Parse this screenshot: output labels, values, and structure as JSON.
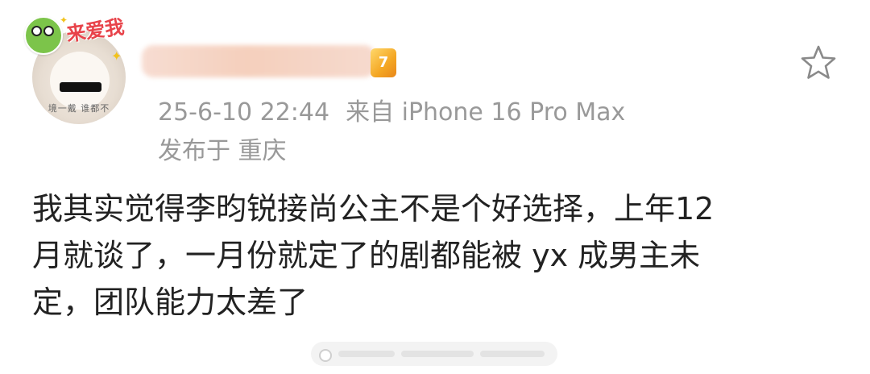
{
  "post": {
    "avatar": {
      "sticker_text": "来爱我",
      "caption": "境一戴 谁都不"
    },
    "meta": {
      "timestamp": "25-6-10 22:44",
      "source": "来自 iPhone 16 Pro Max",
      "location": "发布于 重庆"
    },
    "vip_badge_text": "7",
    "body_lines": [
      "我其实觉得李昀锐接尚公主不是个好选择，上年12",
      "月就谈了，一月份就定了的剧都能被 yx 成男主未",
      "定，团队能力太差了"
    ],
    "actions": {
      "favorite_icon": "star-icon"
    }
  },
  "colors": {
    "meta_text": "#999999",
    "body_text": "#222222",
    "sticker_red": "#e8434a",
    "vip_gold": "#f4a623"
  }
}
